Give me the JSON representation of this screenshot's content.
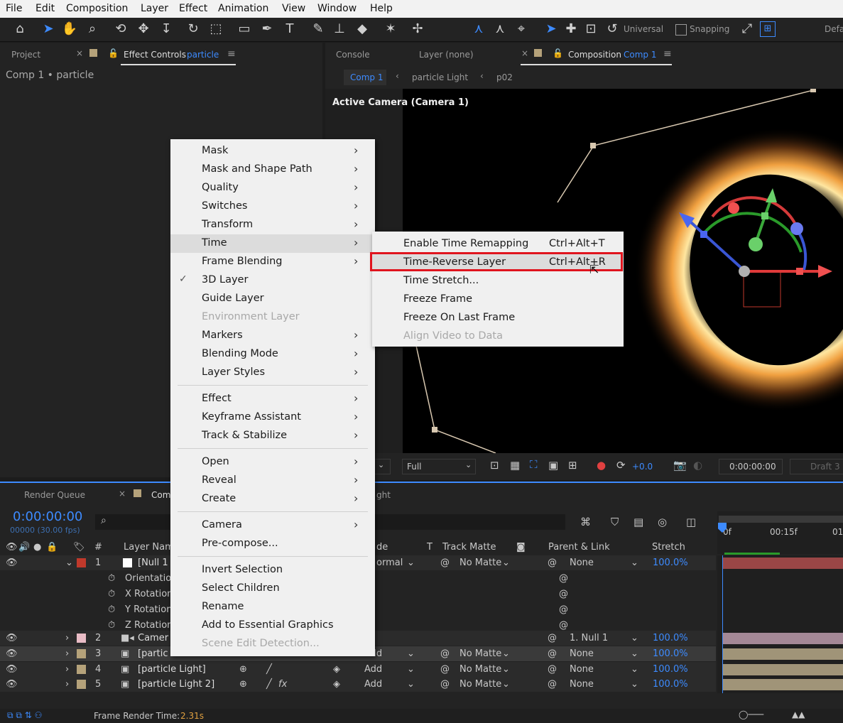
{
  "menubar": [
    "File",
    "Edit",
    "Composition",
    "Layer",
    "Effect",
    "Animation",
    "View",
    "Window",
    "Help"
  ],
  "toolbar": {
    "universal": "Universal",
    "snapping": "Snapping",
    "workspace": "Defa"
  },
  "left_panel": {
    "tab_project": "Project",
    "tab_effect_controls": "Effect Controls",
    "effect_target": "particle",
    "breadcrumb": "Comp 1 • particle"
  },
  "comp_panel": {
    "tab_console": "Console",
    "tab_layer": "Layer (none)",
    "tab_composition": "Composition",
    "comp_name": "Comp 1",
    "crumbs": [
      "Comp 1",
      "particle Light",
      "p02"
    ],
    "camera_label": "Active Camera (Camera 1)",
    "resolution": "Full",
    "exposure": "+0.0",
    "timecode": "0:00:00:00",
    "renderer": "Draft 3"
  },
  "context_menu": {
    "items": [
      {
        "label": "Mask",
        "sub": true,
        "disabled": false,
        "checked": false
      },
      {
        "label": "Mask and Shape Path",
        "sub": true,
        "disabled": false,
        "checked": false
      },
      {
        "label": "Quality",
        "sub": true,
        "disabled": false,
        "checked": false
      },
      {
        "label": "Switches",
        "sub": true,
        "disabled": false,
        "checked": false
      },
      {
        "label": "Transform",
        "sub": true,
        "disabled": false,
        "checked": false
      },
      {
        "label": "Time",
        "sub": true,
        "disabled": false,
        "checked": false,
        "highlight": true
      },
      {
        "label": "Frame Blending",
        "sub": true,
        "disabled": false,
        "checked": false
      },
      {
        "label": "3D Layer",
        "sub": false,
        "disabled": false,
        "checked": true
      },
      {
        "label": "Guide Layer",
        "sub": false,
        "disabled": false,
        "checked": false
      },
      {
        "label": "Environment Layer",
        "sub": false,
        "disabled": true,
        "checked": false
      },
      {
        "label": "Markers",
        "sub": true,
        "disabled": false,
        "checked": false
      },
      {
        "label": "Blending Mode",
        "sub": true,
        "disabled": false,
        "checked": false
      },
      {
        "label": "Layer Styles",
        "sub": true,
        "disabled": false,
        "checked": false
      },
      {
        "label": "Effect",
        "sub": true,
        "disabled": false,
        "checked": false
      },
      {
        "label": "Keyframe Assistant",
        "sub": true,
        "disabled": false,
        "checked": false
      },
      {
        "label": "Track & Stabilize",
        "sub": true,
        "disabled": false,
        "checked": false
      },
      {
        "label": "Open",
        "sub": true,
        "disabled": false,
        "checked": false
      },
      {
        "label": "Reveal",
        "sub": true,
        "disabled": false,
        "checked": false
      },
      {
        "label": "Create",
        "sub": true,
        "disabled": false,
        "checked": false
      },
      {
        "label": "Camera",
        "sub": true,
        "disabled": false,
        "checked": false
      },
      {
        "label": "Pre-compose...",
        "sub": false,
        "disabled": false,
        "checked": false
      },
      {
        "label": "Invert Selection",
        "sub": false,
        "disabled": false,
        "checked": false
      },
      {
        "label": "Select Children",
        "sub": false,
        "disabled": false,
        "checked": false
      },
      {
        "label": "Rename",
        "sub": false,
        "disabled": false,
        "checked": false
      },
      {
        "label": "Add to Essential Graphics",
        "sub": false,
        "disabled": false,
        "checked": false
      },
      {
        "label": "Scene Edit Detection...",
        "sub": false,
        "disabled": true,
        "checked": false
      }
    ]
  },
  "time_submenu": {
    "items": [
      {
        "label": "Enable Time Remapping",
        "shortcut": "Ctrl+Alt+T",
        "disabled": false
      },
      {
        "label": "Time-Reverse Layer",
        "shortcut": "Ctrl+Alt+R",
        "disabled": false,
        "highlight": true
      },
      {
        "label": "Time Stretch...",
        "shortcut": "",
        "disabled": false
      },
      {
        "label": "Freeze Frame",
        "shortcut": "",
        "disabled": false
      },
      {
        "label": "Freeze On Last Frame",
        "shortcut": "",
        "disabled": false
      },
      {
        "label": "Align Video to Data",
        "shortcut": "",
        "disabled": true
      }
    ]
  },
  "timeline": {
    "tab_render_queue": "Render Queue",
    "tab_comp": "Com",
    "timecode": "0:00:00:00",
    "frames": "00000 (30.00 fps)",
    "ruler": [
      "0f",
      "00:15f",
      "01"
    ],
    "headers": {
      "num": "#",
      "layer_name": "Layer Nam",
      "mode": "de",
      "t": "T",
      "track_matte": "Track Matte",
      "parent": "Parent & Link",
      "stretch": "Stretch"
    },
    "layers": [
      {
        "num": "1",
        "name": "[Null 1",
        "color": "#c0392b",
        "mode": "ormal",
        "matte": "No Matte",
        "parent": "None",
        "stretch": "100.0%",
        "bar": "#9a4646"
      },
      {
        "num": "2",
        "name": "Camer",
        "color": "#e9bcc6",
        "mode": "",
        "matte": "",
        "parent": "1. Null 1",
        "stretch": "100.0%",
        "bar": "#a48896"
      },
      {
        "num": "3",
        "name": "[partic",
        "color": "#b5a27a",
        "mode": "Add",
        "matte": "No Matte",
        "parent": "None",
        "stretch": "100.0%",
        "bar": "#a09478"
      },
      {
        "num": "4",
        "name": "[particle Light]",
        "color": "#b5a27a",
        "mode": "Add",
        "matte": "No Matte",
        "parent": "None",
        "stretch": "100.0%",
        "bar": "#a09478"
      },
      {
        "num": "5",
        "name": "[particle Light 2]",
        "color": "#b5a27a",
        "mode": "Add",
        "matte": "No Matte",
        "parent": "None",
        "stretch": "100.0%",
        "bar": "#a09478"
      }
    ],
    "properties": [
      "Orientatio",
      "X Rotation",
      "Y Rotation",
      "Z Rotation"
    ],
    "footer_label": "Frame Render Time:",
    "footer_value": "2.31s"
  }
}
